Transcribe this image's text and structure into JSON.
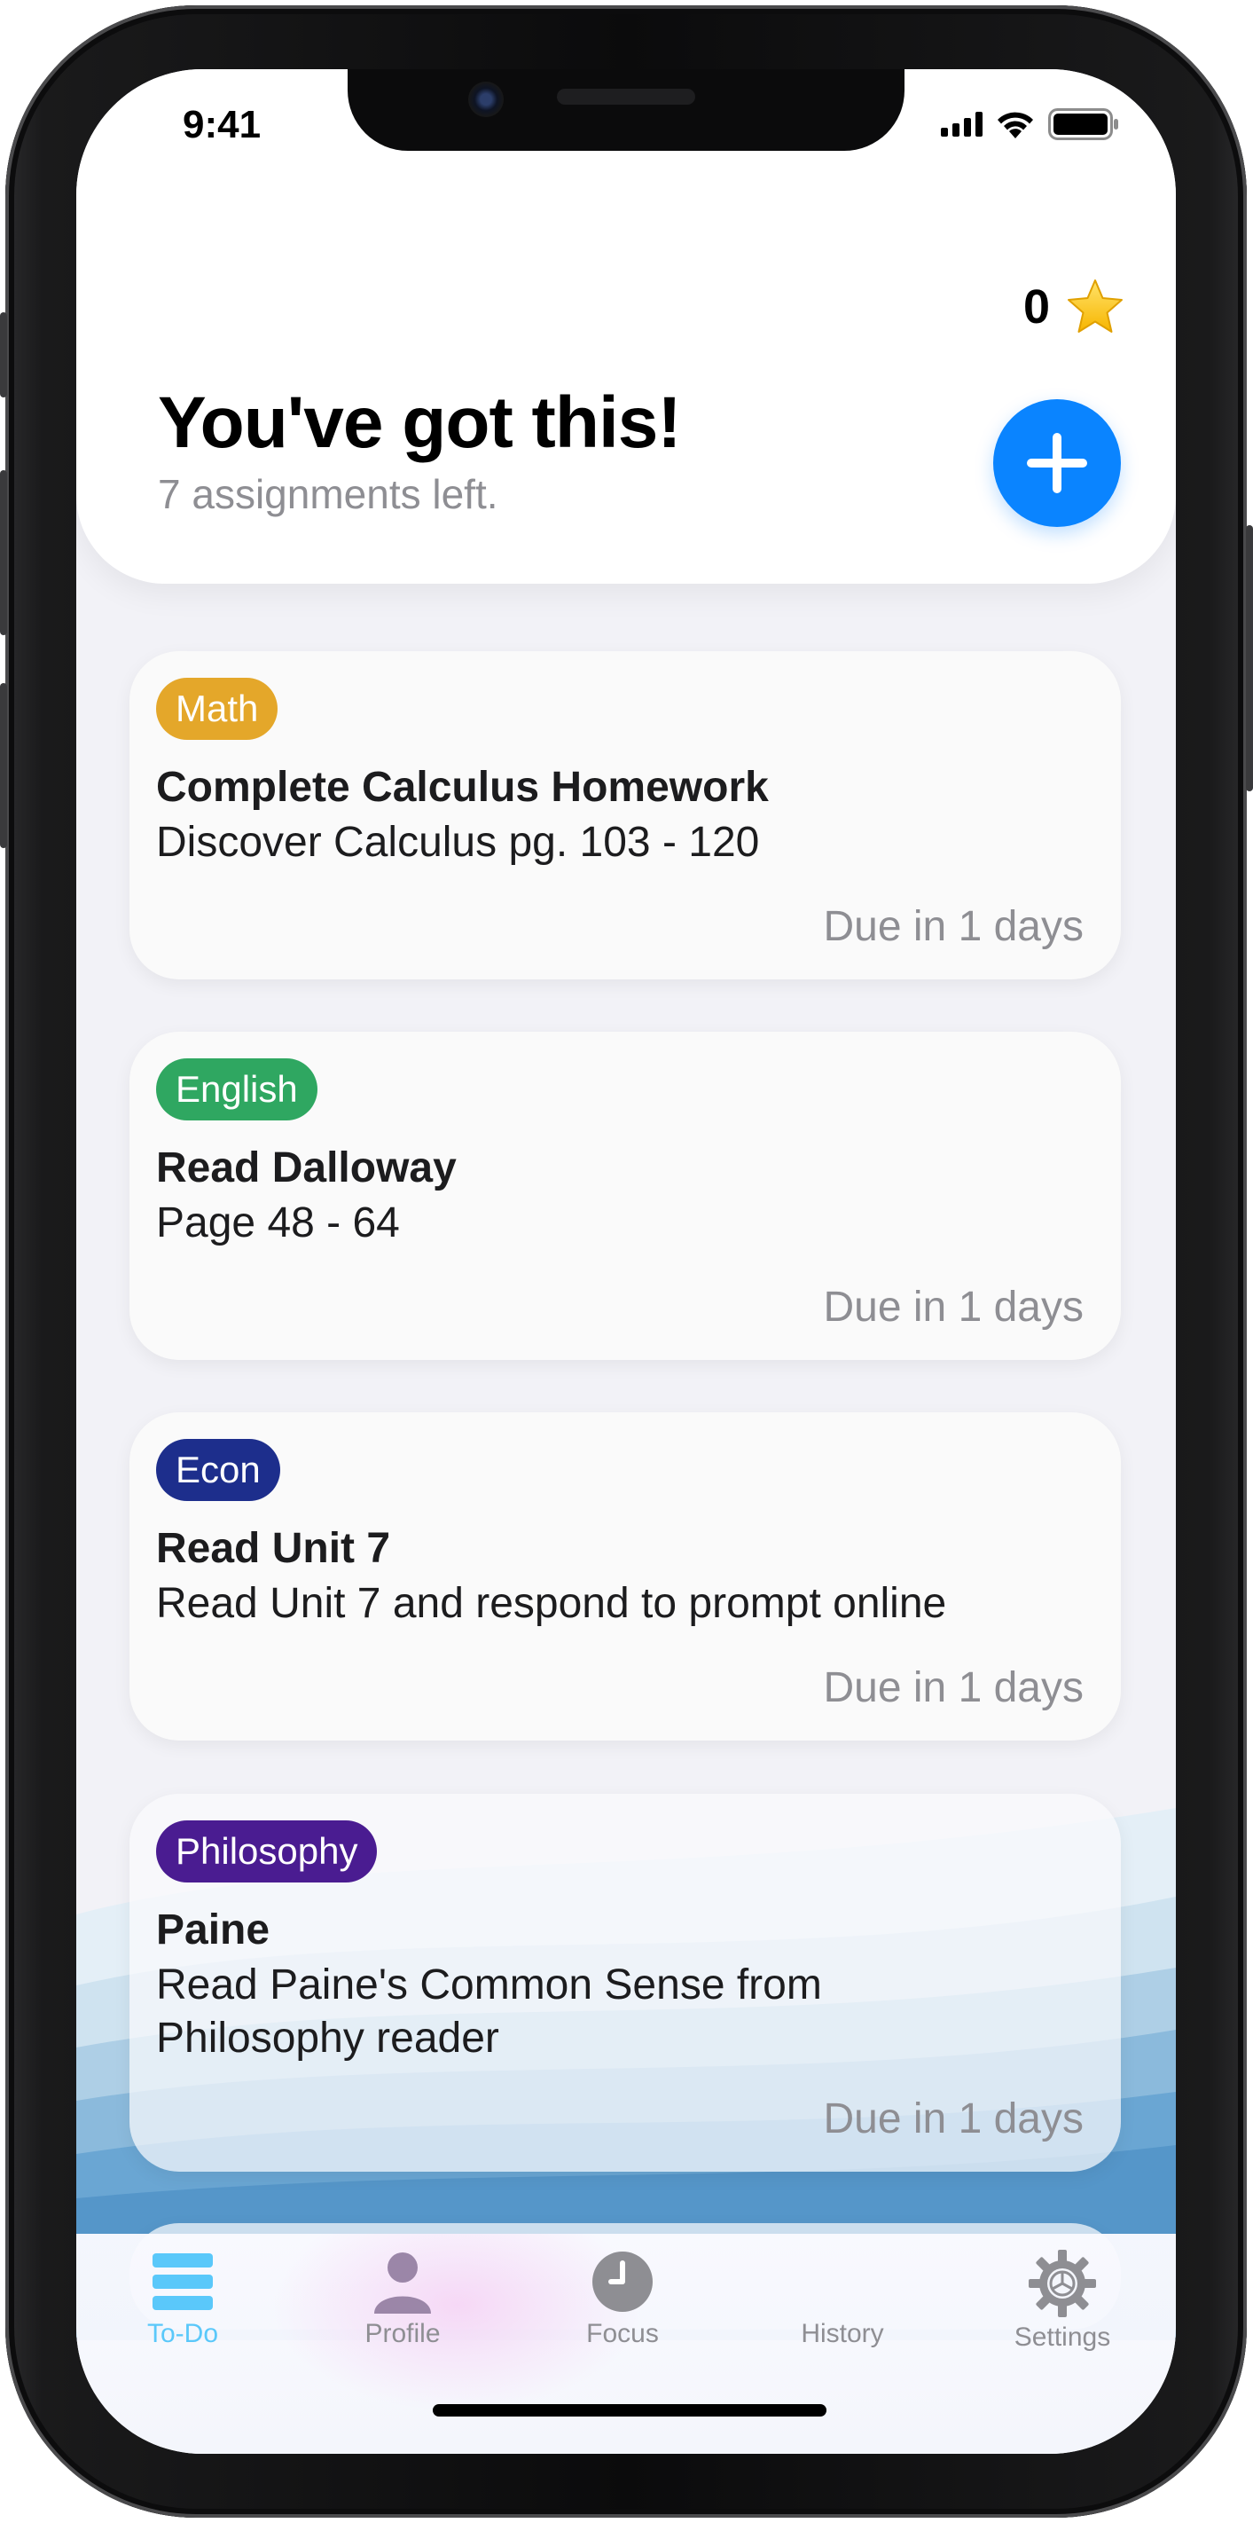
{
  "status_bar": {
    "time": "9:41"
  },
  "header": {
    "stars": "0",
    "title": "You've got this!",
    "subtitle": "7 assignments left."
  },
  "assignments": [
    {
      "tag": "Math",
      "tag_color": "#e4a72a",
      "title": "Complete Calculus Homework",
      "description": "Discover Calculus pg. 103 - 120",
      "due": "Due in 1 days"
    },
    {
      "tag": "English",
      "tag_color": "#2fa761",
      "title": "Read Dalloway",
      "description": "Page 48 - 64",
      "due": "Due in 1 days"
    },
    {
      "tag": "Econ",
      "tag_color": "#1d2e8c",
      "title": "Read Unit 7",
      "description": "Read Unit 7 and respond to prompt online",
      "due": "Due in 1 days"
    },
    {
      "tag": "Philosophy",
      "tag_color": "#4a1c91",
      "title": "Paine",
      "description": "Read Paine's Common Sense from Philosophy reader",
      "due": "Due in 1 days"
    }
  ],
  "tabs": [
    {
      "label": "To-Do",
      "icon": "list-icon",
      "active": true
    },
    {
      "label": "Profile",
      "icon": "person-icon",
      "active": false
    },
    {
      "label": "Focus",
      "icon": "clock-icon",
      "active": false
    },
    {
      "label": "History",
      "icon": "history-icon",
      "active": false
    },
    {
      "label": "Settings",
      "icon": "gear-icon",
      "active": false
    }
  ],
  "colors": {
    "accent_blue": "#0a84ff",
    "tab_active": "#5ac8fa",
    "tab_inactive": "#8e8e93"
  }
}
